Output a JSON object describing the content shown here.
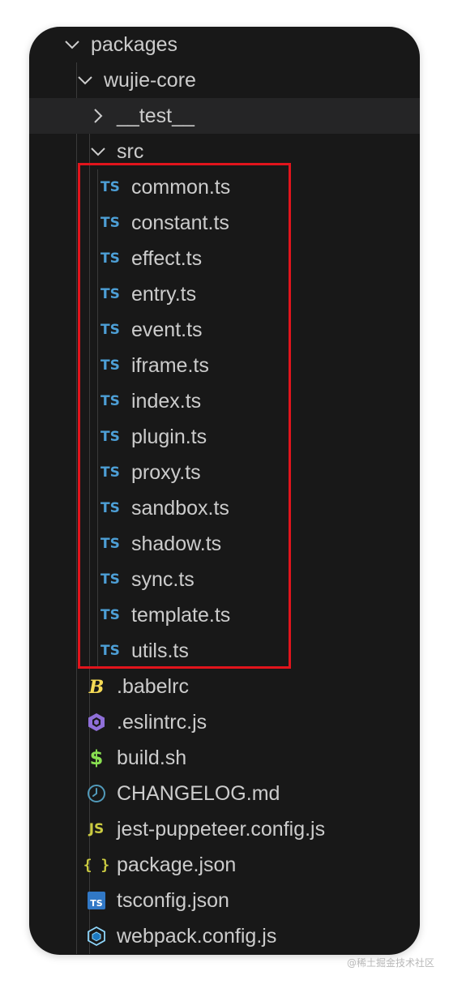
{
  "explorer": {
    "packages": "packages",
    "wujie_core": "wujie-core",
    "test_folder": "__test__",
    "src_folder": "src",
    "src_files": [
      "common.ts",
      "constant.ts",
      "effect.ts",
      "entry.ts",
      "event.ts",
      "iframe.ts",
      "index.ts",
      "plugin.ts",
      "proxy.ts",
      "sandbox.ts",
      "shadow.ts",
      "sync.ts",
      "template.ts",
      "utils.ts"
    ],
    "ts_glyph": "TS",
    "root_files": [
      {
        "name": ".babelrc",
        "icon": "babel-icon"
      },
      {
        "name": ".eslintrc.js",
        "icon": "eslint-icon"
      },
      {
        "name": "build.sh",
        "icon": "shell-icon"
      },
      {
        "name": "CHANGELOG.md",
        "icon": "clock-icon"
      },
      {
        "name": "jest-puppeteer.config.js",
        "icon": "js-icon"
      },
      {
        "name": "package.json",
        "icon": "json-icon"
      },
      {
        "name": "tsconfig.json",
        "icon": "tsconfig-icon"
      },
      {
        "name": "webpack.config.js",
        "icon": "webpack-icon"
      }
    ]
  },
  "glyphs": {
    "js": "JS",
    "json": "{ }",
    "shell": "$",
    "tsconfig": "TS"
  },
  "colors": {
    "panel_bg": "#181818",
    "text": "#cccccc",
    "ts_blue": "#4d9fd6",
    "highlight": "#e1141c",
    "js_yellow": "#cbcb41",
    "shell_green": "#89e051",
    "eslint_purple": "#8f6fd8"
  },
  "watermark": "@稀土掘金技术社区"
}
